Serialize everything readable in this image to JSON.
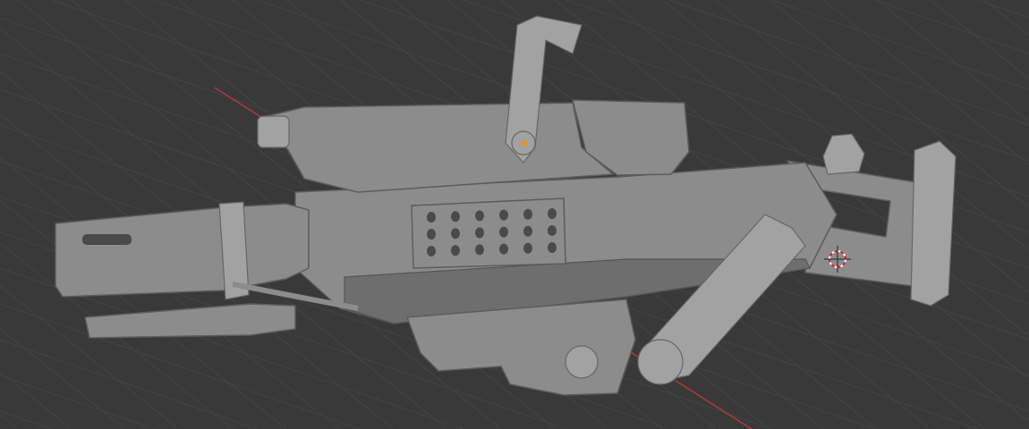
{
  "viewport": {
    "background_color": "#393939",
    "grid_color": "#444444",
    "x_axis_color": "#b03a3a",
    "model_color": "#8c8c8c",
    "origin_dot_color": "#ff8c00"
  },
  "icons": [
    "3d-cursor-icon",
    "object-origin-icon"
  ]
}
